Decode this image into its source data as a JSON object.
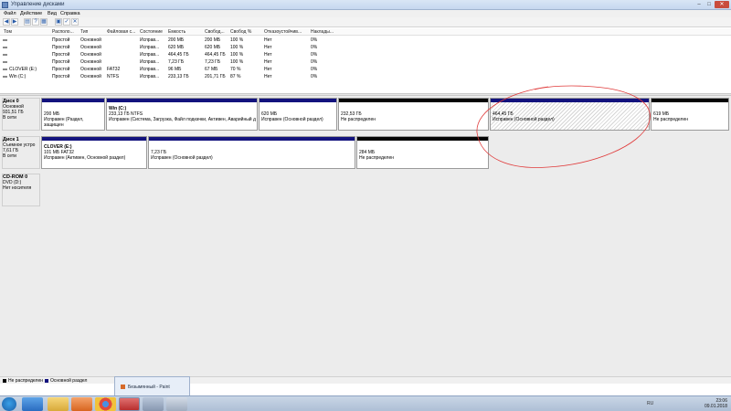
{
  "window": {
    "title": "Управление дисками"
  },
  "menu": [
    "Файл",
    "Действие",
    "Вид",
    "Справка"
  ],
  "toolbar": {
    "icons": [
      "back-icon",
      "forward-icon",
      "properties-icon",
      "help-icon",
      "refresh-icon",
      "connect-icon",
      "check-icon",
      "cancel-icon"
    ]
  },
  "volume_table": {
    "columns": [
      "Том",
      "Располо...",
      "Тип",
      "Файловая с...",
      "Состояние",
      "Емкость",
      "Свобод...",
      "Свобод %",
      "Отказоустойчив...",
      "Наклады..."
    ],
    "rows": [
      {
        "name": "",
        "layout": "Простой",
        "type": "Основной",
        "fs": "",
        "status": "Исправ...",
        "capacity": "200 МБ",
        "free": "200 МБ",
        "free_pct": "100 %",
        "fault": "Нет",
        "overhead": "0%"
      },
      {
        "name": "",
        "layout": "Простой",
        "type": "Основной",
        "fs": "",
        "status": "Исправ...",
        "capacity": "620 МБ",
        "free": "620 МБ",
        "free_pct": "100 %",
        "fault": "Нет",
        "overhead": "0%"
      },
      {
        "name": "",
        "layout": "Простой",
        "type": "Основной",
        "fs": "",
        "status": "Исправ...",
        "capacity": "464,45 ГБ",
        "free": "464,45 ГБ",
        "free_pct": "100 %",
        "fault": "Нет",
        "overhead": "0%"
      },
      {
        "name": "",
        "layout": "Простой",
        "type": "Основной",
        "fs": "",
        "status": "Исправ...",
        "capacity": "7,23 ГБ",
        "free": "7,23 ГБ",
        "free_pct": "100 %",
        "fault": "Нет",
        "overhead": "0%"
      },
      {
        "name": "CLOVER (E:)",
        "layout": "Простой",
        "type": "Основной",
        "fs": "FAT32",
        "status": "Исправ...",
        "capacity": "96 МБ",
        "free": "67 МБ",
        "free_pct": "70 %",
        "fault": "Нет",
        "overhead": "0%"
      },
      {
        "name": "Win (C:)",
        "layout": "Простой",
        "type": "Основной",
        "fs": "NTFS",
        "status": "Исправ...",
        "capacity": "233,13 ГБ",
        "free": "201,71 ГБ",
        "free_pct": "87 %",
        "fault": "Нет",
        "overhead": "0%"
      }
    ]
  },
  "disks": [
    {
      "name": "Диск 0",
      "type": "Основной",
      "size": "931,51 ГБ",
      "status": "В сети",
      "partitions": [
        {
          "line1": "",
          "line2": "200 МБ",
          "line3": "Исправен (Раздел, защищен",
          "kind": "primary"
        },
        {
          "line1": "Win (C:)",
          "line2": "233,13 ГБ NTFS",
          "line3": "Исправен (Система, Загрузка, Файл подкачки, Активен, Аварийный д",
          "kind": "primary"
        },
        {
          "line1": "",
          "line2": "620 МБ",
          "line3": "Исправен (Основной раздел)",
          "kind": "primary"
        },
        {
          "line1": "",
          "line2": "232,53 ГБ",
          "line3": "Не распределен",
          "kind": "unalloc"
        },
        {
          "line1": "",
          "line2": "464,45 ГБ",
          "line3": "Исправен (Основной раздел)",
          "kind": "primary"
        },
        {
          "line1": "",
          "line2": "619 МБ",
          "line3": "Не распределен",
          "kind": "unalloc"
        }
      ]
    },
    {
      "name": "Диск 1",
      "type": "Съемное устро",
      "size": "7,61 ГБ",
      "status": "В сети",
      "partitions": [
        {
          "line1": "CLOVER (E:)",
          "line2": "101 МБ FAT32",
          "line3": "Исправен (Активен, Основной раздел)",
          "kind": "primary"
        },
        {
          "line1": "",
          "line2": "7,23 ГБ",
          "line3": "Исправен (Основной раздел)",
          "kind": "primary"
        },
        {
          "line1": "",
          "line2": "284 МБ",
          "line3": "Не распределен",
          "kind": "unalloc"
        }
      ]
    },
    {
      "name": "CD-ROM 0",
      "type": "DVD (D:)",
      "size": "",
      "status": "Нет носителя",
      "partitions": []
    }
  ],
  "legend": {
    "unallocated": "Не распределен",
    "primary": "Основной раздел"
  },
  "colors": {
    "primary": "#12127d",
    "unallocated": "#050505",
    "annotation": "#e03a3a"
  },
  "paint_popup": {
    "label": "Безымянный - Paint"
  },
  "taskbar": {
    "apps": [
      "start-orb",
      "ie-icon",
      "explorer-icon",
      "media-player-icon",
      "chrome-icon",
      "paint-icon",
      "disk-management-icon",
      "generic-app-icon"
    ],
    "lang": "RU",
    "time": "23:06",
    "date": "09.01.2018"
  }
}
